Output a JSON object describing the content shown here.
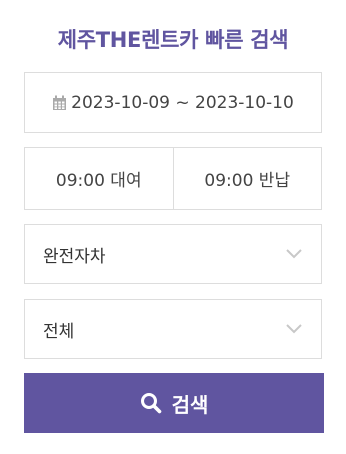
{
  "colors": {
    "brand": "#6055a0",
    "border": "#dddddd",
    "chevron": "#c8c8c8"
  },
  "title": "제주THE렌트카 빠른 검색",
  "date_range": {
    "text": "2023-10-09 ~ 2023-10-10",
    "icon": "calendar-icon"
  },
  "times": {
    "pickup": "09:00 대여",
    "return": "09:00 반납"
  },
  "selects": [
    {
      "value": "완전자차",
      "icon": "chevron-down-icon"
    },
    {
      "value": "전체",
      "icon": "chevron-down-icon"
    }
  ],
  "search": {
    "label": "검색",
    "icon": "search-icon"
  }
}
